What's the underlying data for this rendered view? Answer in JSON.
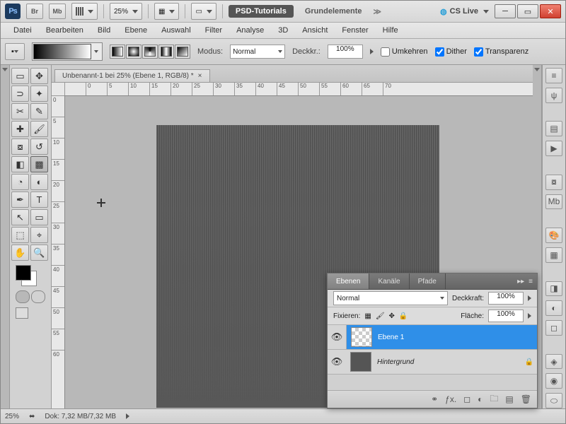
{
  "titlebar": {
    "br_label": "Br",
    "mb_label": "Mb",
    "zoom": "25%",
    "tutorials_tab": "PSD-Tutorials",
    "group_tab": "Grundelemente",
    "cslive": "CS Live"
  },
  "menu": [
    "Datei",
    "Bearbeiten",
    "Bild",
    "Ebene",
    "Auswahl",
    "Filter",
    "Analyse",
    "3D",
    "Ansicht",
    "Fenster",
    "Hilfe"
  ],
  "options": {
    "mode_label": "Modus:",
    "mode_value": "Normal",
    "opacity_label": "Deckkr.:",
    "opacity_value": "100%",
    "reverse": "Umkehren",
    "dither": "Dither",
    "transp": "Transparenz"
  },
  "doc": {
    "tab_title": "Unbenannt-1 bei 25% (Ebene 1, RGB/8) *"
  },
  "ruler_h": [
    "",
    "0",
    "5",
    "10",
    "15",
    "20",
    "25",
    "30",
    "35",
    "40",
    "45",
    "50",
    "55",
    "60",
    "65",
    "70"
  ],
  "ruler_v": [
    "0",
    "5",
    "10",
    "15",
    "20",
    "25",
    "30",
    "35",
    "40",
    "45",
    "50",
    "55",
    "60"
  ],
  "status": {
    "zoom": "25%",
    "docinfo": "Dok: 7,32 MB/7,32 MB"
  },
  "layers": {
    "tabs": [
      "Ebenen",
      "Kanäle",
      "Pfade"
    ],
    "blend_value": "Normal",
    "opacity_label": "Deckkraft:",
    "opacity_value": "100%",
    "lock_label": "Fixieren:",
    "fill_label": "Fläche:",
    "fill_value": "100%",
    "items": [
      {
        "name": "Ebene 1",
        "selected": true,
        "locked": false,
        "italic": false
      },
      {
        "name": "Hintergrund",
        "selected": false,
        "locked": true,
        "italic": true
      }
    ]
  }
}
